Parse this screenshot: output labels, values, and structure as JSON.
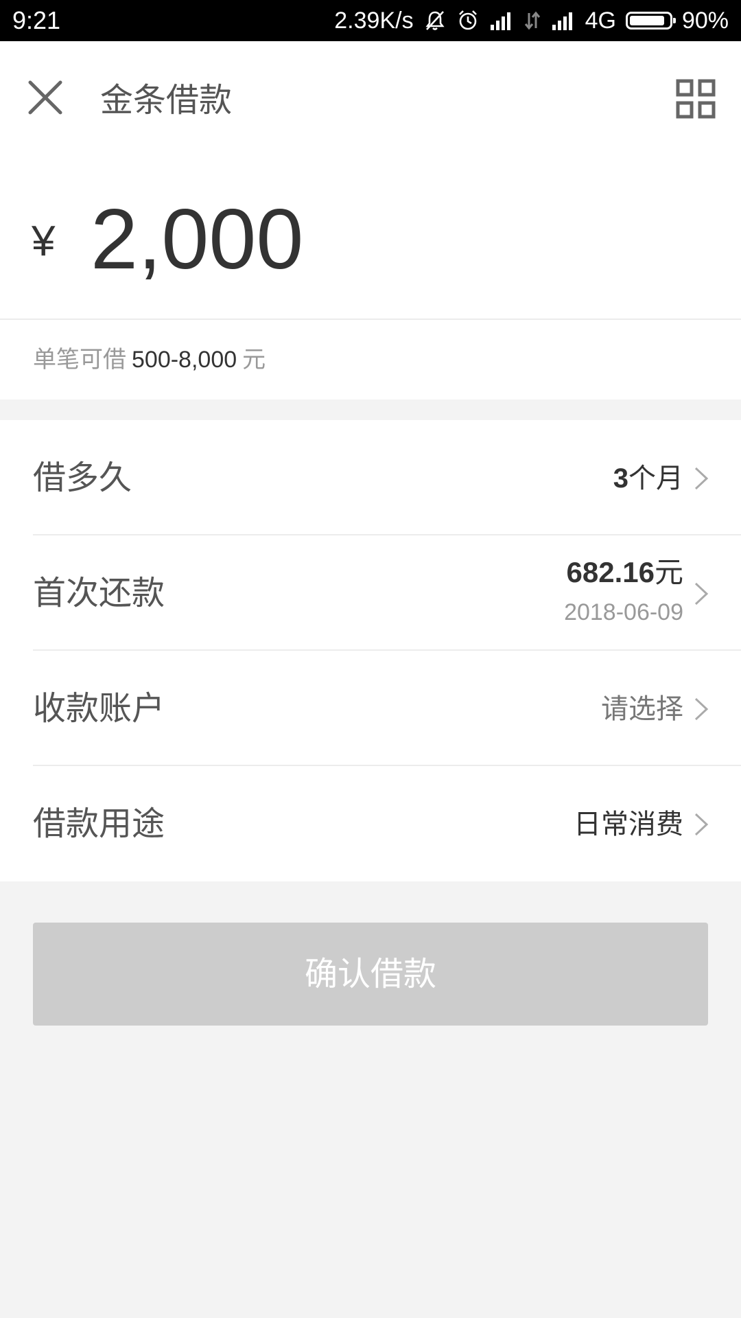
{
  "status_bar": {
    "time": "9:21",
    "network_speed": "2.39K/s",
    "network_type": "4G",
    "battery_percent": "90%",
    "battery_level": 0.9,
    "icons": [
      "mute-icon",
      "alarm-icon",
      "signal-icon",
      "data-arrows-icon",
      "signal-icon"
    ]
  },
  "header": {
    "title": "金条借款",
    "close_icon": "close-icon",
    "menu_icon": "grid-icon"
  },
  "amount": {
    "currency_symbol": "¥",
    "value": "2,000"
  },
  "range": {
    "prefix": "单笔可借",
    "value": "500-8,000",
    "unit": "元"
  },
  "form": {
    "duration": {
      "label": "借多久",
      "value_number": "3",
      "value_unit": "个月"
    },
    "first_repayment": {
      "label": "首次还款",
      "amount": "682.16",
      "amount_unit": "元",
      "date": "2018-06-09"
    },
    "account": {
      "label": "收款账户",
      "value": "请选择"
    },
    "purpose": {
      "label": "借款用途",
      "value": "日常消费"
    }
  },
  "confirm_button": {
    "label": "确认借款"
  },
  "colors": {
    "background": "#f3f3f3",
    "card": "#ffffff",
    "text_primary": "#333333",
    "text_secondary": "#999999",
    "button_disabled": "#cccccc"
  }
}
